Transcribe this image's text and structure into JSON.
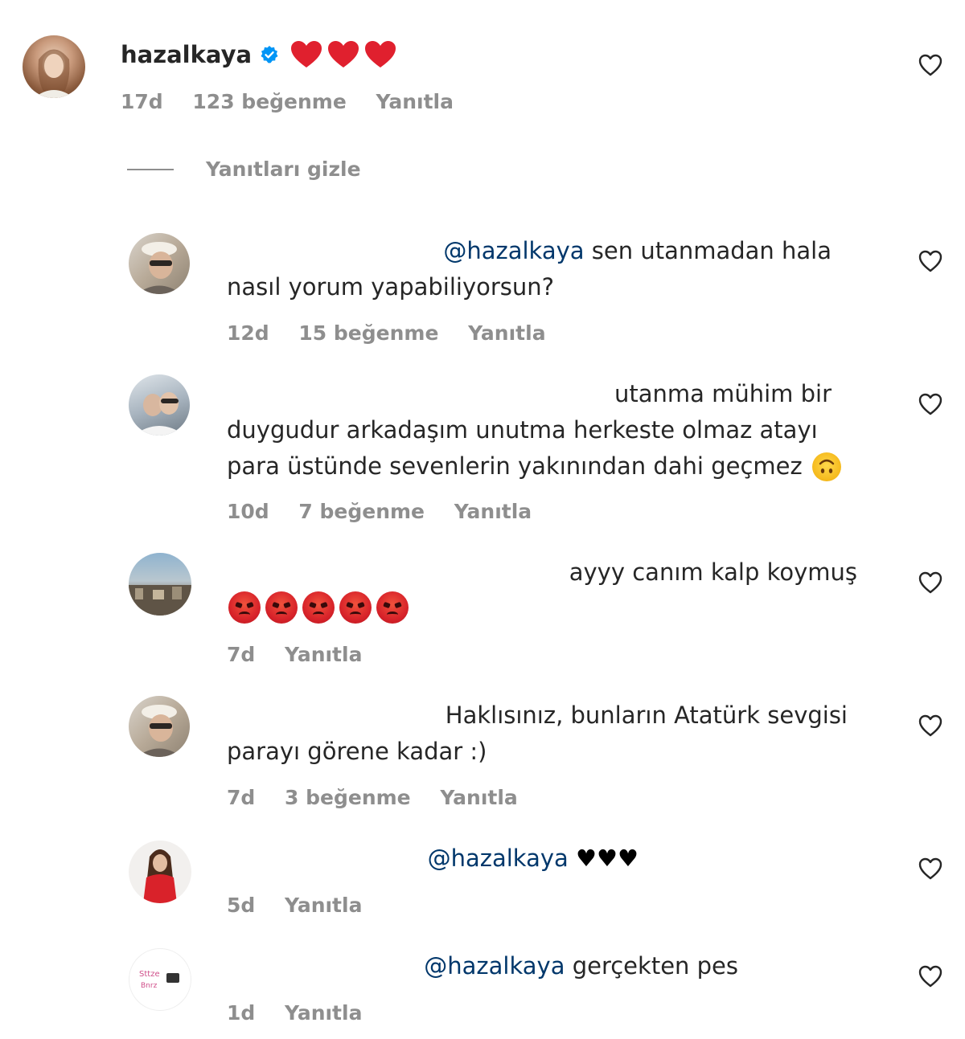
{
  "top_comment": {
    "username": "hazalkaya",
    "text_emoji": "❤❤❤",
    "time": "17d",
    "likes": "123 beğenme",
    "reply_label": "Yanıtla"
  },
  "hide_replies_label": "Yanıtları gizle",
  "replies": [
    {
      "mention": "@hazalkaya",
      "line1_rest": " sen utanmadan hala",
      "line2": "nasıl yorum yapabiliyorsun?",
      "time": "12d",
      "likes": "15 beğenme",
      "reply_label": "Yanıtla"
    },
    {
      "line1": "utanma mühim bir",
      "line2": "duygudur arkadaşım unutma herkeste olmaz atayı",
      "line3": "para üstünde sevenlerin yakınından dahi geçmez",
      "time": "10d",
      "likes": "7 beğenme",
      "reply_label": "Yanıtla"
    },
    {
      "line1": "ayyy canım kalp koymuş",
      "time": "7d",
      "reply_label": "Yanıtla"
    },
    {
      "line1": "Haklısınız, bunların Atatürk sevgisi",
      "line2": "parayı görene kadar :)",
      "time": "7d",
      "likes": "3 beğenme",
      "reply_label": "Yanıtla"
    },
    {
      "mention": "@hazalkaya",
      "line1_rest": " ♥♥♥",
      "time": "5d",
      "reply_label": "Yanıtla"
    },
    {
      "mention": "@hazalkaya",
      "line1_rest": " gerçekten pes",
      "time": "1d",
      "reply_label": "Yanıtla"
    }
  ],
  "colors": {
    "text": "#262626",
    "meta": "#8e8e8e",
    "mention": "#00376b",
    "verified": "#0095f6",
    "heart_red": "#e0202e"
  },
  "icons": {
    "like": "heart-outline-icon",
    "verified": "verified-badge-icon"
  }
}
